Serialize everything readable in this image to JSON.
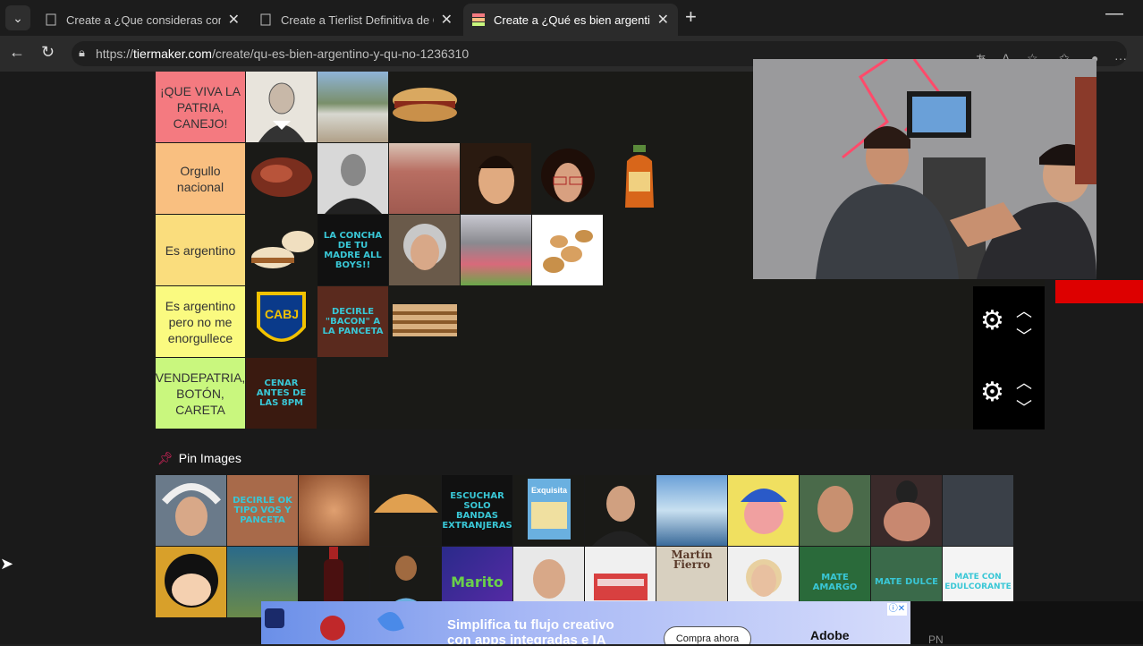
{
  "browser": {
    "tabs": [
      {
        "title": "Create a ¿Que consideras como inc",
        "active": false
      },
      {
        "title": "Create a Tierlist Definitiva de Com",
        "active": false
      },
      {
        "title": "Create a ¿Qué es bien argentino y",
        "active": true
      }
    ],
    "url_prefix": "https://",
    "url_domain": "tiermaker.com",
    "url_path": "/create/qu-es-bien-argentino-y-qu-no-1236310"
  },
  "tiers": [
    {
      "label": "¡QUE VIVA LA PATRIA, CANEJO!",
      "color": "#f47a80",
      "images": [
        "portrait-sketch",
        "waterfall",
        "choripan"
      ]
    },
    {
      "label": "Orgullo nacional",
      "color": "#f9bf80",
      "images": [
        "asado",
        "old-man-bw",
        "casa-rosada",
        "man-smiling",
        "man-glasses",
        "sauce-bottle"
      ]
    },
    {
      "label": "Es argentino",
      "color": "#fadd7d",
      "images": [
        "alfajores",
        "la-concha-de-tu-madre-all-boys",
        "grandmother",
        "flowers-crowd",
        "bread-rolls"
      ]
    },
    {
      "label": "Es argentino pero no me enorgullece",
      "color": "#fafa80",
      "images": [
        "boca-juniors-crest",
        "decirle-bacon-a-la-panceta",
        "layered-cake"
      ]
    },
    {
      "label": "VENDEPATRIA, BOTÓN, CARETA",
      "color": "#c9f77e",
      "images": [
        "cenar-antes-de-las-8pm"
      ]
    }
  ],
  "captions": {
    "la-concha": "LA CONCHA DE TU MADRE ALL BOYS!!",
    "decirle": "DECIRLE \"BACON\" A LA PANCETA",
    "cenar": "CENAR ANTES DE LAS 8PM",
    "decirle-ok": "DECIRLE OK TIPO VOS Y PANCETA",
    "escuchar": "ESCUCHAR SOLO BANDAS EXTRANJERAS",
    "mate-amargo": "MATE AMARGO",
    "mate-dulce": "MATE DULCE",
    "mate-con": "MATE CON EDULCORANTE",
    "martin-fierro": "Martín Fierro",
    "marito": "Marito",
    "exquisita": "Exquisita",
    "cabj": "CABJ"
  },
  "pin": {
    "label": "Pin Images"
  },
  "ad": {
    "headline_1": "Simplifica tu flujo creativo",
    "headline_2": "con apps integradas e IA",
    "cta": "Compra ahora",
    "brand": "Adobe"
  },
  "footer_text": "PN",
  "accent": {
    "red": "#dd0000",
    "pin": "#e0245e",
    "caption": "#39c7d6"
  }
}
